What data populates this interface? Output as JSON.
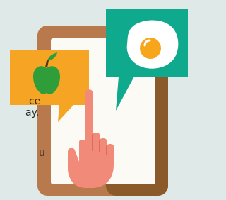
{
  "text_fragments": [
    "ce",
    "ay.",
    "u"
  ],
  "colors": {
    "background": "#dfeae8",
    "tablet_frame": "#b8794d",
    "tablet_frame_dark": "#8b5a2b",
    "tablet_screen": "#fbfaf5",
    "orange_bubble": "#f5a523",
    "green_apple": "#2f9e3a",
    "apple_stem": "#5a3412",
    "teal_bubble": "#0fa98d",
    "egg_white": "#ffffff",
    "egg_yolk": "#f7a51b",
    "hand": "#f28a7a"
  },
  "icons": [
    "tablet-icon",
    "apple-icon",
    "fried-egg-icon",
    "pointing-hand-icon"
  ]
}
